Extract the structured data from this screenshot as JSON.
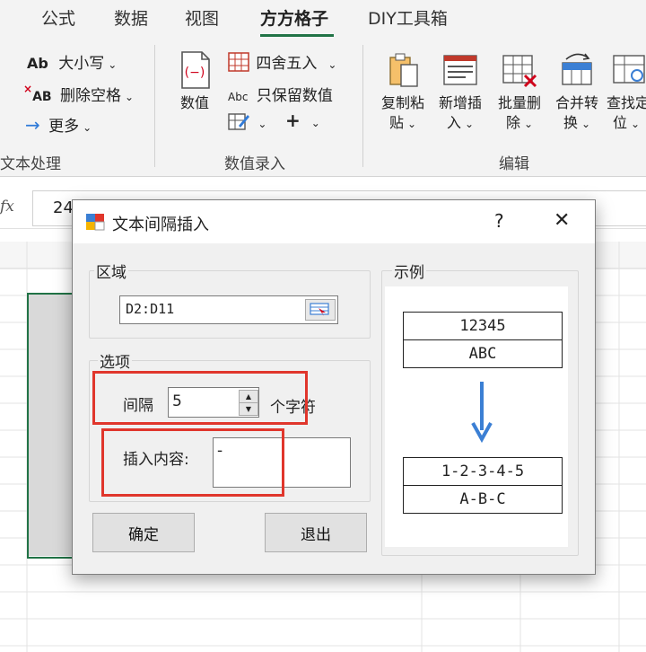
{
  "ribbon": {
    "tabs": [
      {
        "label": "公式"
      },
      {
        "label": "数据"
      },
      {
        "label": "视图"
      },
      {
        "label": "方方格子"
      },
      {
        "label": "DIY工具箱"
      }
    ],
    "text_group": {
      "case_label": "大小写",
      "case_icon_text": "Ab",
      "delete_space_label": "删除空格",
      "delete_space_icon_text": "AB",
      "more_label": "更多",
      "group_label": "文本处理"
    },
    "number_group": {
      "value_label": "数值",
      "round_label": "四舍五入",
      "keep_value_label": "只保留数值",
      "keep_value_icon_text": "Abc",
      "plus_label": "+",
      "group_label": "数值录入"
    },
    "edit_group": {
      "buttons": [
        {
          "line1": "复制粘",
          "line2": "贴"
        },
        {
          "line1": "新增插",
          "line2": "入"
        },
        {
          "line1": "批量删",
          "line2": "除"
        },
        {
          "line1": "合并转",
          "line2": "换"
        },
        {
          "line1": "查找定",
          "line2": "位"
        }
      ],
      "group_label": "编辑"
    }
  },
  "formula_bar": {
    "fx_label": "fx",
    "value": "24"
  },
  "dialog": {
    "title": "文本间隔插入",
    "help_label": "?",
    "close_label": "✕",
    "range_group": {
      "title": "区域",
      "value": "D2:D11"
    },
    "options_group": {
      "title": "选项",
      "interval_label": "间隔",
      "interval_value": "5",
      "interval_unit": "个字符",
      "insert_label": "插入内容:",
      "insert_value": "-"
    },
    "example_group": {
      "title": "示例",
      "before": [
        "12345",
        "ABC"
      ],
      "after": [
        "1-2-3-4-5",
        "A-B-C"
      ]
    },
    "ok_label": "确定",
    "exit_label": "退出"
  },
  "colors": {
    "accent": "#217346",
    "highlight": "#e0362c",
    "arrow": "#3b7fd4"
  }
}
